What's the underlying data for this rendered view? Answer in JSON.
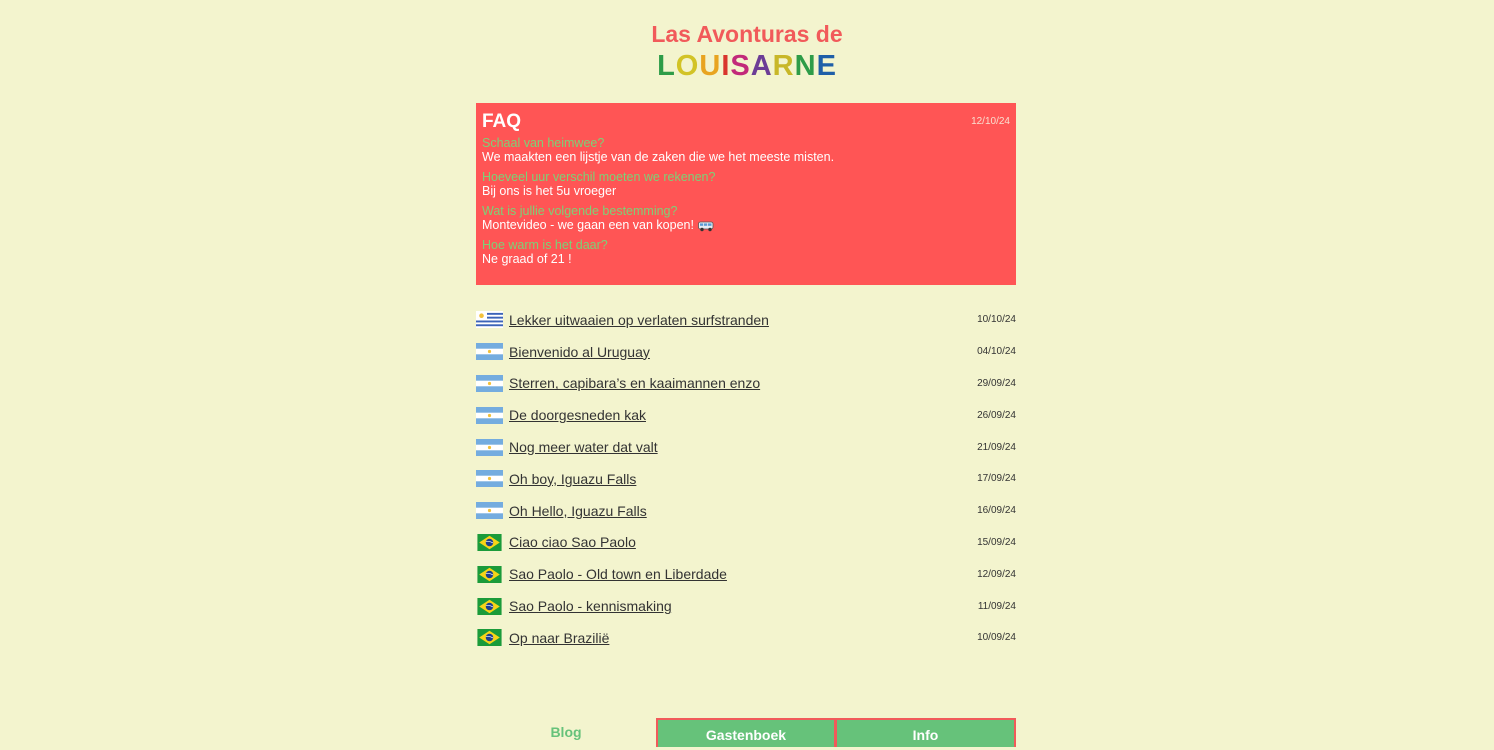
{
  "header": {
    "subtitle": "Las Avonturas de",
    "logo_letters": [
      {
        "char": "L",
        "color": "#2e9c48"
      },
      {
        "char": "O",
        "color": "#d2c326"
      },
      {
        "char": "U",
        "color": "#e8a420"
      },
      {
        "char": "I",
        "color": "#d9352d"
      },
      {
        "char": "S",
        "color": "#c2297a"
      },
      {
        "char": "A",
        "color": "#6c3d96"
      },
      {
        "char": "R",
        "color": "#c8b728"
      },
      {
        "char": "N",
        "color": "#2e9c48"
      },
      {
        "char": "E",
        "color": "#1f5fa8"
      }
    ]
  },
  "faq": {
    "title": "FAQ",
    "date": "12/10/24",
    "items": [
      {
        "q": "Schaal van heimwee?",
        "a": "We maakten een lijstje van de zaken die we het meeste misten."
      },
      {
        "q": "Hoeveel uur verschil moeten we rekenen?",
        "a": "Bij ons is het 5u vroeger"
      },
      {
        "q": "Wat is jullie volgende bestemming?",
        "a": "Montevideo - we gaan een van kopen!"
      },
      {
        "q": "Hoe warm is het daar?",
        "a": "Ne graad of 21 !"
      }
    ]
  },
  "posts": [
    {
      "flag": "uruguay-flag-icon",
      "title": "Lekker uitwaaien op verlaten surfstranden",
      "date": "10/10/24"
    },
    {
      "flag": "argentina-flag-icon",
      "title": "Bienvenido al Uruguay",
      "date": "04/10/24"
    },
    {
      "flag": "argentina-flag-icon",
      "title": "Sterren, capibara’s en kaaimannen enzo",
      "date": "29/09/24"
    },
    {
      "flag": "argentina-flag-icon",
      "title": "De doorgesneden kak",
      "date": "26/09/24"
    },
    {
      "flag": "argentina-flag-icon",
      "title": "Nog meer water dat valt",
      "date": "21/09/24"
    },
    {
      "flag": "argentina-flag-icon",
      "title": "Oh boy, Iguazu Falls",
      "date": "17/09/24"
    },
    {
      "flag": "argentina-flag-icon",
      "title": "Oh Hello, Iguazu Falls",
      "date": "16/09/24"
    },
    {
      "flag": "brazil-flag-icon",
      "title": "Ciao ciao Sao Paolo",
      "date": "15/09/24"
    },
    {
      "flag": "brazil-flag-icon",
      "title": "Sao Paolo - Old town en Liberdade",
      "date": "12/09/24"
    },
    {
      "flag": "brazil-flag-icon",
      "title": "Sao Paolo - kennismaking",
      "date": "11/09/24"
    },
    {
      "flag": "brazil-flag-icon",
      "title": "Op naar Brazilië",
      "date": "10/09/24"
    }
  ],
  "nav": {
    "blog": "Blog",
    "guestbook": "Gastenboek",
    "info": "Info"
  },
  "colors": {
    "background": "#f3f4ce",
    "faq_background": "#ff5555",
    "faq_question": "#7dd177",
    "nav_green": "#66c27a",
    "subtitle": "#f15a5a"
  }
}
